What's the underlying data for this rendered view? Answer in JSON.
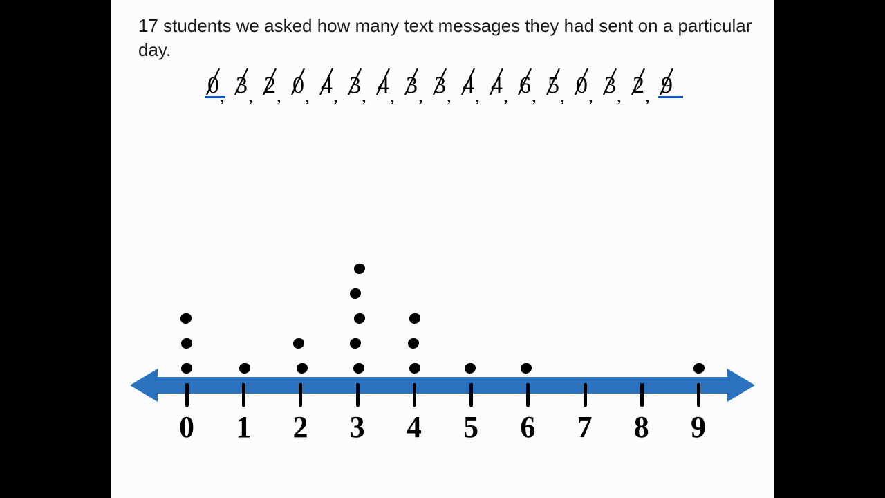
{
  "prompt_text": "17 students we asked how many text messages they had sent on a particular day.",
  "raw_values": [
    0,
    3,
    2,
    0,
    4,
    3,
    4,
    3,
    3,
    4,
    4,
    6,
    5,
    0,
    3,
    2,
    9
  ],
  "chart_data": {
    "type": "dotplot",
    "title": "",
    "xlabel": "",
    "ylabel": "",
    "x_ticks": [
      0,
      1,
      2,
      3,
      4,
      5,
      6,
      7,
      8,
      9
    ],
    "series": [
      {
        "name": "students",
        "x": 0,
        "count": 3
      },
      {
        "name": "students",
        "x": 1,
        "count": 1
      },
      {
        "name": "students",
        "x": 2,
        "count": 2
      },
      {
        "name": "students",
        "x": 3,
        "count": 5
      },
      {
        "name": "students",
        "x": 4,
        "count": 3
      },
      {
        "name": "students",
        "x": 5,
        "count": 1
      },
      {
        "name": "students",
        "x": 6,
        "count": 1
      },
      {
        "name": "students",
        "x": 7,
        "count": 0
      },
      {
        "name": "students",
        "x": 8,
        "count": 0
      },
      {
        "name": "students",
        "x": 9,
        "count": 1
      }
    ],
    "xlim": [
      0,
      9
    ],
    "ylim": [
      0,
      5
    ]
  }
}
